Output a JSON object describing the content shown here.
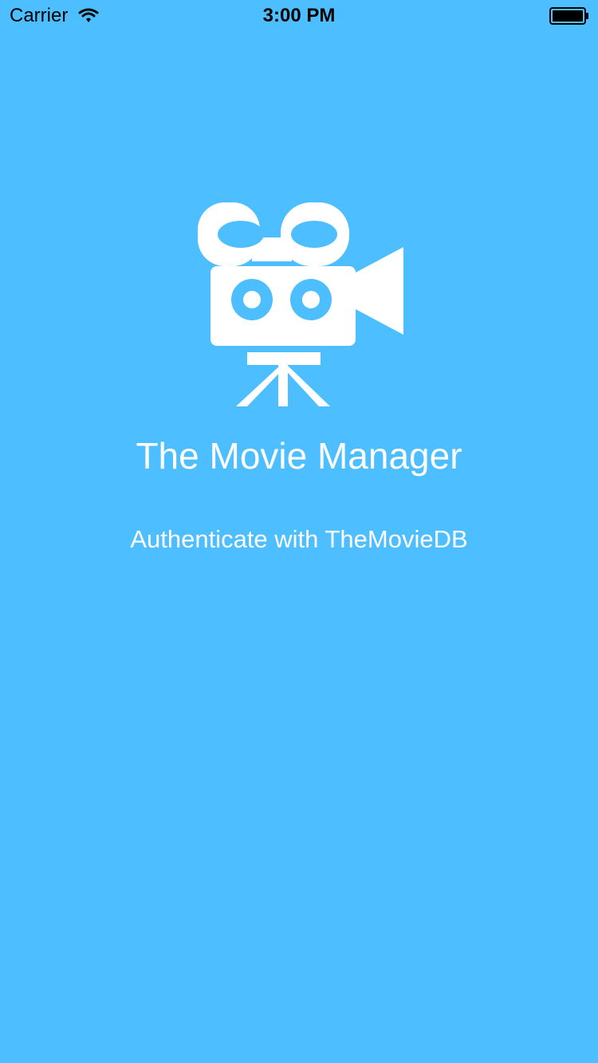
{
  "status_bar": {
    "carrier": "Carrier",
    "time": "3:00 PM",
    "wifi_icon": "wifi-icon",
    "battery_icon": "battery-icon"
  },
  "logo": {
    "icon": "movie-camera-icon",
    "color": "#ffffff"
  },
  "main": {
    "title": "The Movie Manager",
    "auth_button_label": "Authenticate with TheMovieDB"
  },
  "theme": {
    "background": "#4DBEFF",
    "text_color": "#FFFFFF"
  }
}
